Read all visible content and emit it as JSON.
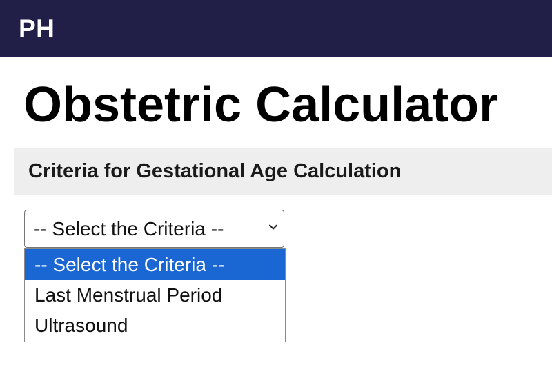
{
  "header": {
    "logo_text": "PH",
    "background_color": "#211f47"
  },
  "page": {
    "title": "Obstetric Calculator"
  },
  "section": {
    "title": "Criteria for Gestational Age Calculation"
  },
  "criteria_select": {
    "selected_value": "-- Select the Criteria --",
    "expanded": true,
    "options": [
      {
        "label": "-- Select the Criteria --",
        "highlighted": true
      },
      {
        "label": "Last Menstrual Period",
        "highlighted": false
      },
      {
        "label": "Ultrasound",
        "highlighted": false
      }
    ],
    "highlight_color": "#1a66d2",
    "icon": "chevron-down-icon"
  }
}
